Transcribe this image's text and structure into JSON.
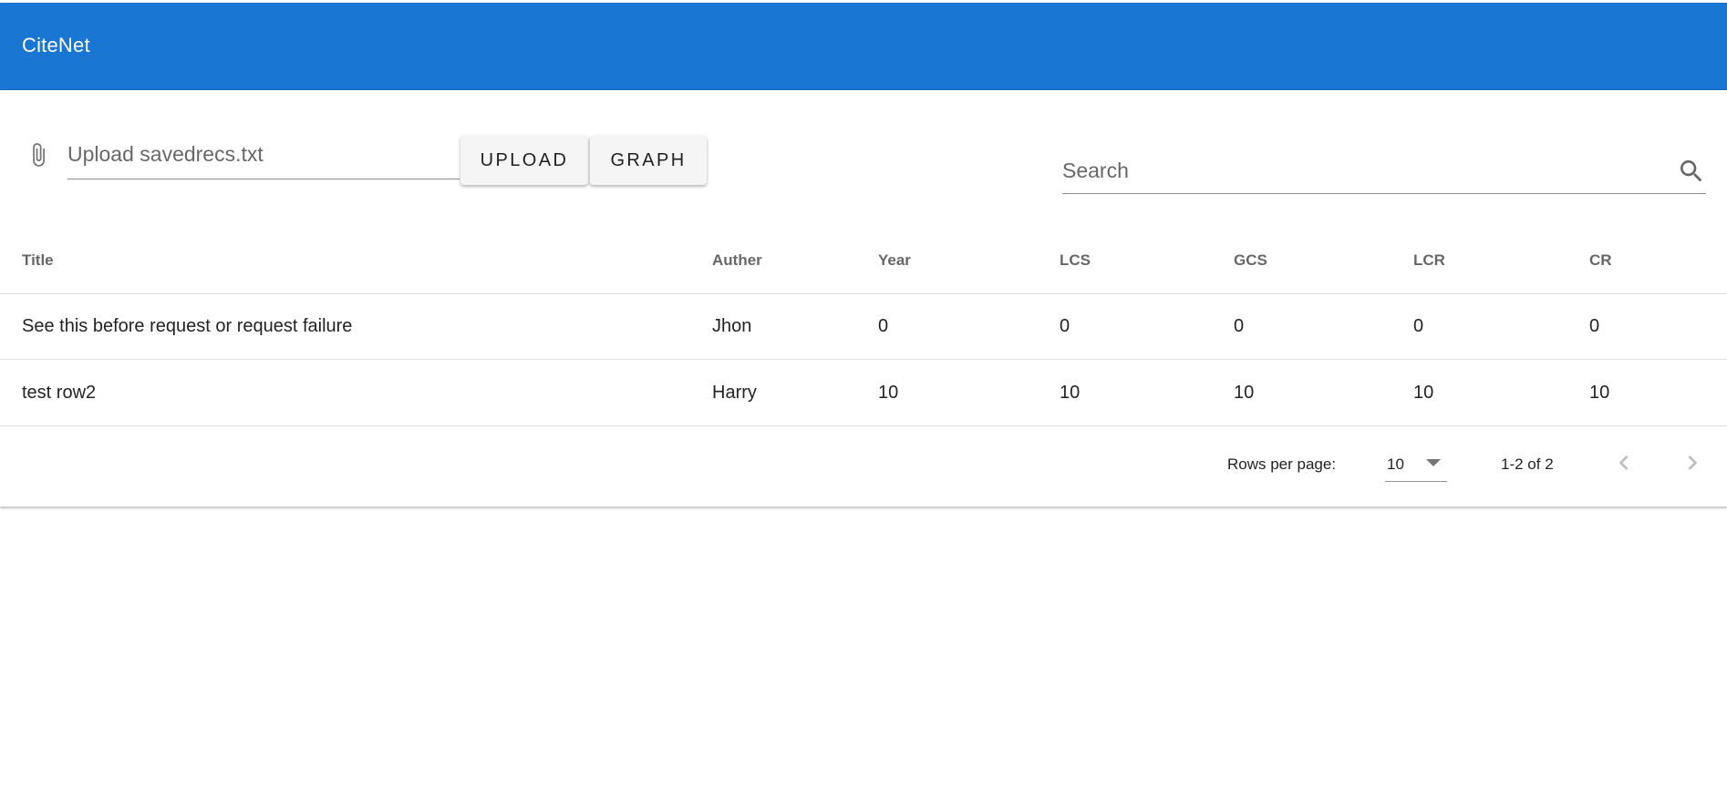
{
  "app": {
    "title": "CiteNet"
  },
  "toolbar": {
    "upload_placeholder": "Upload savedrecs.txt",
    "upload_button": "UPLOAD",
    "graph_button": "GRAPH",
    "search_placeholder": "Search"
  },
  "table": {
    "headers": {
      "title": "Title",
      "author": "Auther",
      "year": "Year",
      "lcs": "LCS",
      "gcs": "GCS",
      "lcr": "LCR",
      "cr": "CR"
    },
    "rows": [
      {
        "title": "See this before request or request failure",
        "author": "Jhon",
        "year": "0",
        "lcs": "0",
        "gcs": "0",
        "lcr": "0",
        "cr": "0"
      },
      {
        "title": "test row2",
        "author": "Harry",
        "year": "10",
        "lcs": "10",
        "gcs": "10",
        "lcr": "10",
        "cr": "10"
      }
    ]
  },
  "pagination": {
    "rows_per_page_label": "Rows per page:",
    "rows_per_page_value": "10",
    "range": "1-2 of 2"
  },
  "colors": {
    "appbar": "#1976d2",
    "button_bg": "#f5f5f5"
  },
  "icons": {
    "attach": "paperclip-icon",
    "search": "search-icon",
    "dropdown": "chevron-down-icon",
    "prev": "chevron-left-icon",
    "next": "chevron-right-icon"
  }
}
